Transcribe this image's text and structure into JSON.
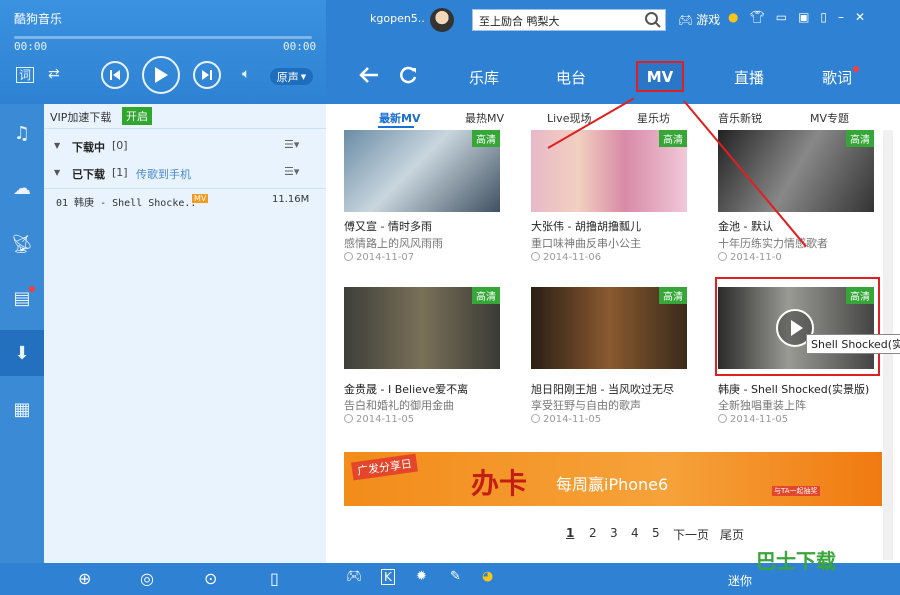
{
  "app": {
    "title": "酷狗音乐"
  },
  "player": {
    "time_current": "00:00",
    "time_total": "00:00",
    "lyrics_icon": "词",
    "mode_label": "原声"
  },
  "topbar": {
    "username": "kgopen5..",
    "search_text": "至上励合 鸭梨大",
    "games_label": "游戏"
  },
  "nav": {
    "items": [
      "乐库",
      "电台",
      "MV",
      "直播",
      "歌词"
    ]
  },
  "subtabs": [
    "最新MV",
    "最热MV",
    "Live现场",
    "星乐坊",
    "音乐新锐",
    "MV专题"
  ],
  "download": {
    "vip_label": "VIP加速下载",
    "vip_toggle": "开启",
    "downloading_label": "下载中",
    "downloading_count": "[0]",
    "downloaded_label": "已下载",
    "downloaded_count": "[1]",
    "sync_link": "传歌到手机",
    "song": "01 韩庚 - Shell Shocke..",
    "song_tag": "MV",
    "song_size": "11.16M"
  },
  "cards": [
    {
      "title": "傅又宣 - 情时多雨",
      "sub": "感情路上的风风雨雨",
      "date": "2014-11-07",
      "hq": "高清"
    },
    {
      "title": "大张伟 - 胡撸胡撸瓢儿",
      "sub": "重口味神曲反串小公主",
      "date": "2014-11-06",
      "hq": "高清"
    },
    {
      "title": "金池 - 默认",
      "sub": "十年历练实力情感歌者",
      "date": "2014-11-0",
      "hq": "高清"
    },
    {
      "title": "金贵晟 - I Believe爱不离",
      "sub": "告白和婚礼的御用金曲",
      "date": "2014-11-05",
      "hq": "高清"
    },
    {
      "title": "旭日阳刚王旭 - 当风吹过无尽",
      "sub": "享受狂野与自由的歌声",
      "date": "2014-11-05",
      "hq": "高清"
    },
    {
      "title": "韩庚 - Shell Shocked(实景版)",
      "sub": "全新独唱重装上阵",
      "date": "2014-11-05",
      "hq": "高清"
    }
  ],
  "tooltip": "Shell Shocked(实景",
  "banner": {
    "tag": "广发分享日",
    "big": "办卡",
    "small": "每周赢iPhone6",
    "sticker": "与TA一起抽奖"
  },
  "pager": {
    "pages": [
      "1",
      "2",
      "3",
      "4",
      "5"
    ],
    "next": "下一页",
    "last": "尾页"
  },
  "bottom": {
    "right_text": "迷你"
  },
  "watermark": "巴士下载",
  "colors": {
    "accent": "#2f82d3",
    "highlight": "#e02020",
    "hd_badge": "#35a637"
  }
}
